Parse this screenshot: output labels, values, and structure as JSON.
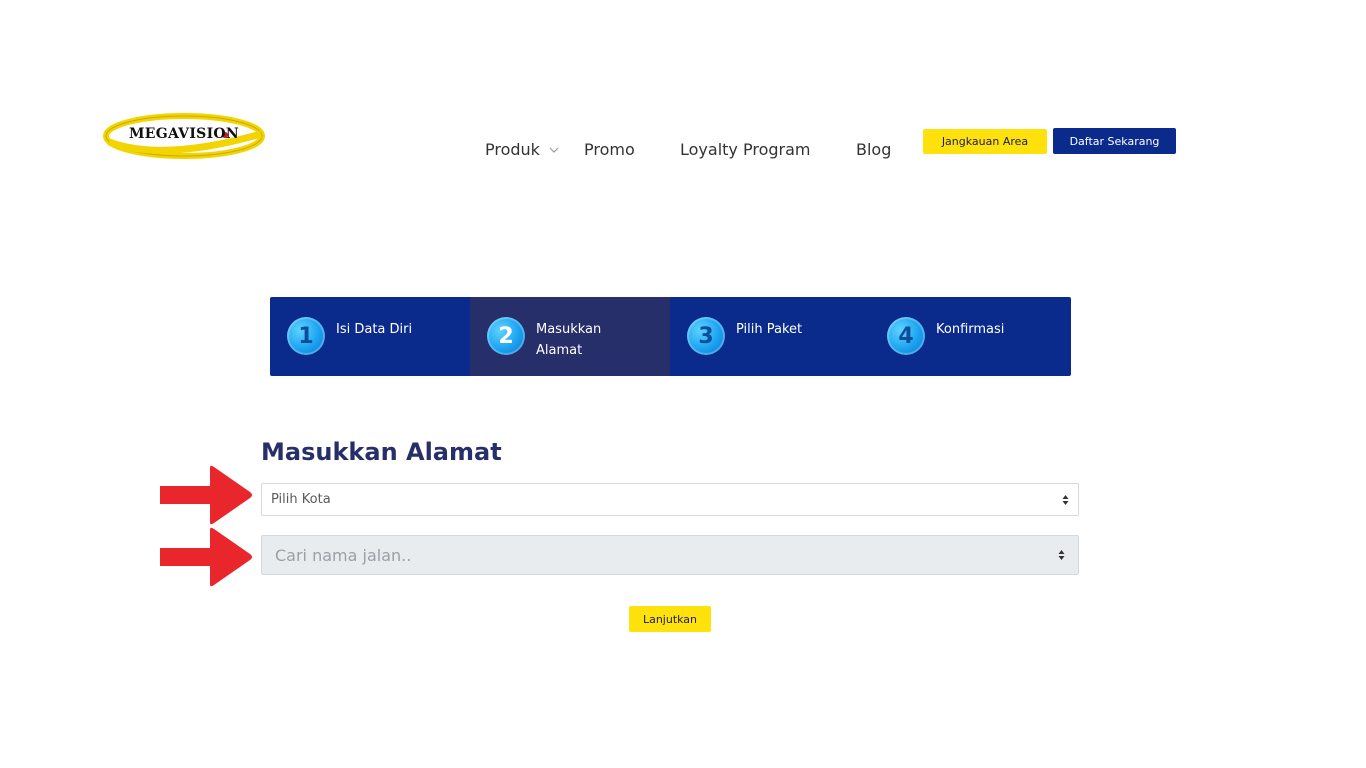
{
  "logo": {
    "text": "MEGAVISION",
    "colors": {
      "ring": "#f2d500",
      "ring_dark": "#c9a800",
      "text": "#111111",
      "dot": "#d0142c"
    }
  },
  "nav": {
    "items": [
      {
        "label": "Produk",
        "has_dropdown": true
      },
      {
        "label": "Promo"
      },
      {
        "label": "Loyalty Program"
      },
      {
        "label": "Blog"
      }
    ],
    "jangkauan_label": "Jangkauan Area",
    "daftar_label": "Daftar Sekarang"
  },
  "stepper": {
    "active_index": 1,
    "steps": [
      {
        "number": "1",
        "label": "Isi Data Diri"
      },
      {
        "number": "2",
        "label": "Masukkan Alamat"
      },
      {
        "number": "3",
        "label": "Pilih Paket"
      },
      {
        "number": "4",
        "label": "Konfirmasi"
      }
    ]
  },
  "form": {
    "title": "Masukkan Alamat",
    "kota_select": {
      "value": "Pilih Kota"
    },
    "jalan_select": {
      "placeholder": "Cari nama jalan.."
    },
    "submit_label": "Lanjutkan"
  },
  "colors": {
    "primary_blue": "#0b2b8c",
    "active_step": "#262f6a",
    "yellow": "#ffe10b",
    "arrow_red": "#e8262b"
  },
  "icons": {
    "dropdown": "chevron-down-icon",
    "select_caret": "up-down-caret-icon",
    "annotation_arrow": "red-arrow-icon"
  }
}
